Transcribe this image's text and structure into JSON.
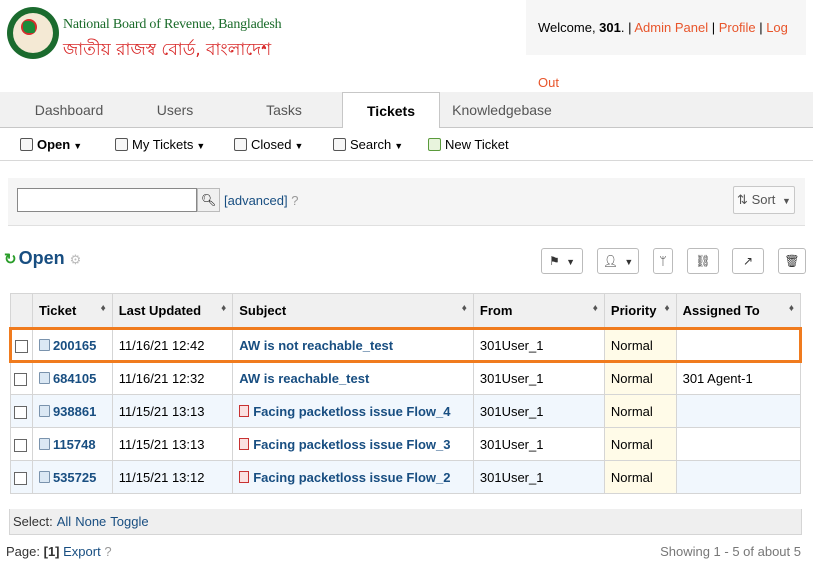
{
  "header": {
    "org_en": "National Board of Revenue, Bangladesh",
    "org_bn": "জাতীয় রাজস্ব বোর্ড, বাংলাদেশ",
    "welcome_prefix": "Welcome, ",
    "user": "301",
    "welcome_dot": ".",
    "sep": " | ",
    "admin_panel": "Admin Panel",
    "profile": "Profile",
    "logout": "Log Out"
  },
  "tabs": [
    {
      "label": "Dashboard"
    },
    {
      "label": "Users"
    },
    {
      "label": "Tasks"
    },
    {
      "label": "Tickets",
      "active": true
    },
    {
      "label": "Knowledgebase"
    }
  ],
  "subnav": {
    "open": "Open",
    "my_tickets": "My Tickets",
    "closed": "Closed",
    "search": "Search",
    "new_ticket": "New Ticket"
  },
  "search": {
    "value": "",
    "advanced": "[advanced]",
    "sort": "Sort"
  },
  "page_title": "Open",
  "table": {
    "headers": [
      "Ticket",
      "Last Updated",
      "Subject",
      "From",
      "Priority",
      "Assigned To"
    ],
    "rows": [
      {
        "ticket": "200165",
        "updated": "11/16/21 12:42",
        "subject": "AW is not reachable_test",
        "from": "301User_1",
        "priority": "Normal",
        "assigned": "",
        "attach": false
      },
      {
        "ticket": "684105",
        "updated": "11/16/21 12:32",
        "subject": "AW is reachable_test",
        "from": "301User_1",
        "priority": "Normal",
        "assigned": "301 Agent-1",
        "attach": false
      },
      {
        "ticket": "938861",
        "updated": "11/15/21 13:13",
        "subject": "Facing packetloss issue Flow_4",
        "from": "301User_1",
        "priority": "Normal",
        "assigned": "",
        "attach": true
      },
      {
        "ticket": "115748",
        "updated": "11/15/21 13:13",
        "subject": "Facing packetloss issue Flow_3",
        "from": "301User_1",
        "priority": "Normal",
        "assigned": "",
        "attach": true
      },
      {
        "ticket": "535725",
        "updated": "11/15/21 13:12",
        "subject": "Facing packetloss issue Flow_2",
        "from": "301User_1",
        "priority": "Normal",
        "assigned": "",
        "attach": true
      }
    ]
  },
  "select": {
    "label": "Select:",
    "all": "All",
    "none": "None",
    "toggle": "Toggle"
  },
  "footer": {
    "page_label": "Page:",
    "page_current": "[1]",
    "export": "Export",
    "showing": "Showing 1 - 5 of about 5"
  }
}
